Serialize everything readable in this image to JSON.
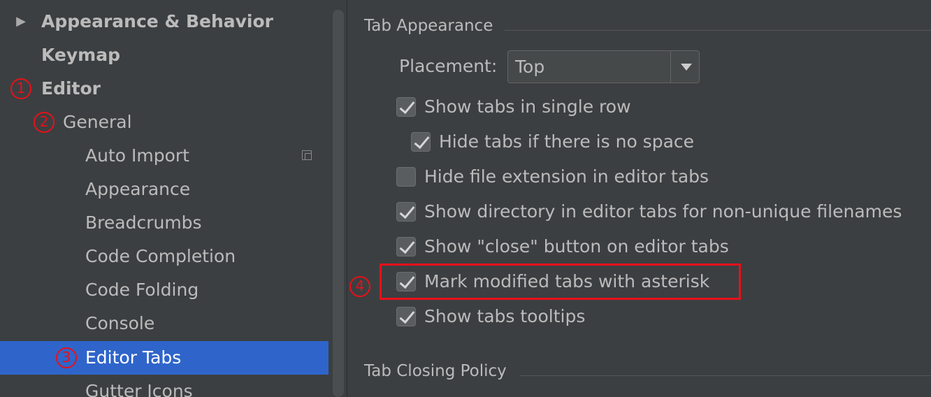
{
  "sidebar": {
    "items": [
      {
        "label": "Appearance & Behavior",
        "arrow": "▶"
      },
      {
        "label": "Keymap"
      },
      {
        "label": "Editor",
        "annotation": "1"
      },
      {
        "label": "General",
        "annotation": "2"
      },
      {
        "label": "Auto Import",
        "icon": "copy-icon"
      },
      {
        "label": "Appearance"
      },
      {
        "label": "Breadcrumbs"
      },
      {
        "label": "Code Completion"
      },
      {
        "label": "Code Folding"
      },
      {
        "label": "Console"
      },
      {
        "label": "Editor Tabs",
        "annotation": "3",
        "selected": true
      },
      {
        "label": "Gutter Icons"
      }
    ]
  },
  "panel": {
    "tab_appearance_title": "Tab Appearance",
    "placement_label": "Placement:",
    "placement_value": "Top",
    "checkboxes": [
      {
        "label": "Show tabs in single row",
        "checked": true
      },
      {
        "label": "Hide tabs if there is no space",
        "checked": true
      },
      {
        "label": "Hide file extension in editor tabs",
        "checked": false
      },
      {
        "label": "Show directory in editor tabs for non-unique filenames",
        "checked": true
      },
      {
        "label": "Show \"close\" button on editor tabs",
        "checked": true
      },
      {
        "label": "Mark modified tabs with asterisk",
        "checked": true,
        "annotation": "4"
      },
      {
        "label": "Show tabs tooltips",
        "checked": true
      }
    ],
    "tab_closing_title": "Tab Closing Policy"
  },
  "colors": {
    "background": "#3c3f41",
    "selection": "#2f65ca",
    "annotation_red": "#e8101a",
    "text": "#bbbbbb"
  }
}
